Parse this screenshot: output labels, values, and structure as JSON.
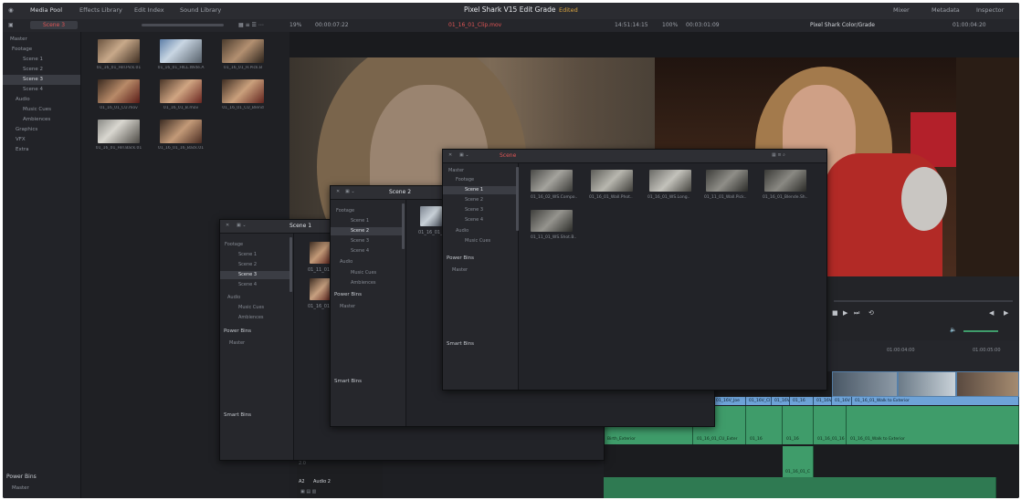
{
  "app": {
    "title": "Pixel Shark V15 Edit Grade",
    "status": "Edited",
    "logo": "DaVinci Resolve",
    "top_tabs": [
      "Media Pool",
      "Effects Library",
      "Edit Index",
      "Sound Library"
    ],
    "right_tabs": [
      "Mixer",
      "Metadata",
      "Inspector"
    ]
  },
  "toolbar": {
    "bin": "Scene 3",
    "zoom": "19%",
    "left_timecode": "00:00:07:22",
    "clip_name": "01_16_01_Clip.mov",
    "source_tc": "14:51:14:15",
    "zoom2": "100%",
    "timeline_tc": "00:03:01:09",
    "timeline_name": "Pixel Shark Color/Grade",
    "record_tc": "01:00:04:20"
  },
  "sidebar": {
    "master": "Master",
    "footage": "Footage",
    "scenes": [
      "Scene 1",
      "Scene 2",
      "Scene 3",
      "Scene 4"
    ],
    "audio": "Audio",
    "audio_items": [
      "Music Cues",
      "Ambiences"
    ],
    "graphics": "Graphics",
    "vfx": "VFX",
    "extra": "Extra",
    "power_bins": "Power Bins",
    "power_master": "Master"
  },
  "pool_clips": [
    "01_16_01_Hill.Pick.01",
    "01_16_01_HILL.Wide.A",
    "01_16_01_H.Pick.B",
    "01_16_01_CU.mov",
    "01_16_01_B.mov",
    "01_16_01_CU_Blend",
    "01_16_01_Hill.Back.01",
    "01_16_01_16_Back.01"
  ],
  "win_scene1": {
    "title": "Scene 1",
    "footage": "Footage",
    "scenes": [
      "Scene 1",
      "Scene 2",
      "Scene 3",
      "Scene 4"
    ],
    "audio": "Audio",
    "audio_items": [
      "Music Cues",
      "Ambiences"
    ],
    "power_bins": "Power Bins",
    "master": "Master",
    "smart_bins": "Smart Bins",
    "clips": [
      "01_11_01",
      "01_16_01_CU"
    ]
  },
  "win_scene2": {
    "title": "Scene 2",
    "footage": "Footage",
    "scenes": [
      "Scene 1",
      "Scene 2",
      "Scene 3",
      "Scene 4"
    ],
    "audio": "Audio",
    "audio_items": [
      "Music Cues",
      "Ambiences"
    ],
    "power_bins": "Power Bins",
    "master": "Master",
    "smart_bins": "Smart Bins",
    "clip": "01_16_01_CU.mov"
  },
  "win_scene3": {
    "title": "Scene",
    "footage": "Footage",
    "scenes": [
      "Scene 1",
      "Scene 2",
      "Scene 3",
      "Scene 4"
    ],
    "audio": "Audio",
    "audio_items": [
      "Music Cues"
    ],
    "power_bins": "Power Bins",
    "master": "Master",
    "smart_bins": "Smart Bins",
    "clips": [
      "01_16_02_WS.Compo..",
      "01_16_01_Wall.Phot..",
      "01_16_01_WS.Long..",
      "01_11_01_Wall.Pick..",
      "01_16_01_Blende.Sh..",
      "01_11_01_WS.Shot.B.."
    ]
  },
  "timeline": {
    "timecode": "01:00:04:00",
    "end_tc": "01:00:05:00",
    "video_clips": [
      "01_16V_Joe",
      "01_16V_Cl",
      "01_16V",
      "01_16",
      "01_16V",
      "01_16V",
      "01_16_01_Walk to Exterior"
    ],
    "audio_clips": [
      "Birth_Exterior",
      "01_16_01_CU_Exter",
      "01_16",
      "01_16",
      "01_16_01_16",
      "01_16_01_Walk to Exterior"
    ],
    "a2_clip": "01_16_01_C",
    "audio_track_label": "Audio 2",
    "audio_track_id": "A2",
    "audio_level": "2.0"
  },
  "colors": {
    "background": "#1e1f23",
    "panel": "#222328",
    "accent_blue": "#6ea3d8",
    "audio_green": "#3f9c6a",
    "edited_orange": "#d9a441",
    "clip_red": "#e05555"
  }
}
